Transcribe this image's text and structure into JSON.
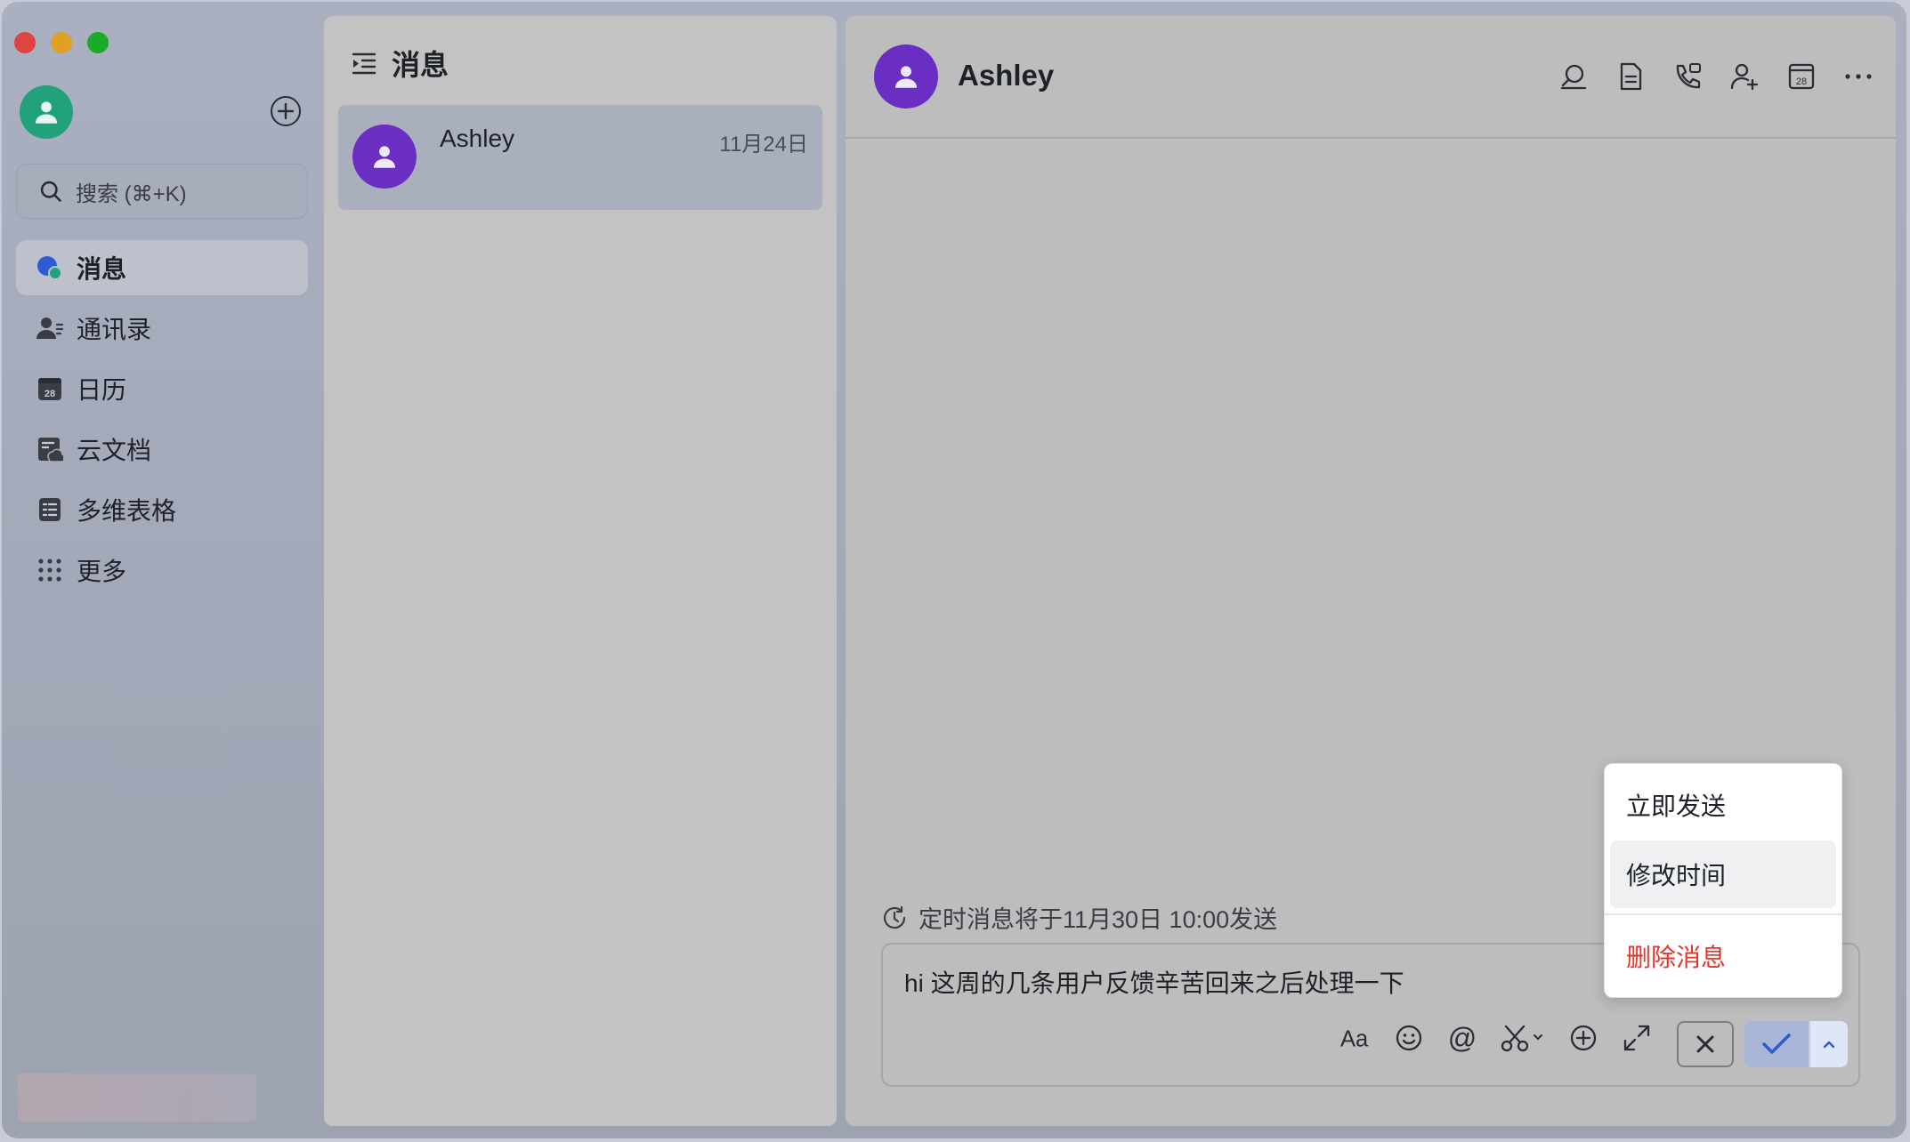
{
  "sidebar": {
    "search_placeholder": "搜索 (⌘+K)",
    "items": [
      {
        "label": "消息",
        "icon": "chat-bubbles-icon",
        "active": true
      },
      {
        "label": "通讯录",
        "icon": "contacts-icon",
        "active": false
      },
      {
        "label": "日历",
        "icon": "calendar-icon",
        "active": false,
        "icon_text": "28"
      },
      {
        "label": "云文档",
        "icon": "cloud-docs-icon",
        "active": false
      },
      {
        "label": "多维表格",
        "icon": "table-icon",
        "active": false
      },
      {
        "label": "更多",
        "icon": "grid-dots-icon",
        "active": false
      }
    ]
  },
  "message_list": {
    "title": "消息",
    "conversations": [
      {
        "name": "Ashley",
        "date": "11月24日"
      }
    ]
  },
  "chat": {
    "contact_name": "Ashley",
    "header_icons": [
      "search-chat-icon",
      "document-icon",
      "phone-call-icon",
      "add-member-icon",
      "calendar-icon",
      "more-icon"
    ],
    "calendar_icon_text": "28",
    "scheduled_notice": "定时消息将于11月30日 10:00发送",
    "draft_message": "hi 这周的几条用户反馈辛苦回来之后处理一下",
    "toolbar": [
      "text-format-icon",
      "emoji-icon",
      "mention-icon",
      "screenshot-icon",
      "add-icon",
      "expand-icon"
    ],
    "text_format_glyph": "Aa",
    "mention_glyph": "@"
  },
  "schedule_menu": {
    "items": [
      {
        "label": "立即发送"
      },
      {
        "label": "修改时间"
      },
      {
        "label": "删除消息"
      }
    ]
  },
  "colors": {
    "accent_purple": "#6a2fc2",
    "self_avatar": "#21a27a",
    "danger": "#e5342a",
    "confirm": "#2f5bd0"
  }
}
